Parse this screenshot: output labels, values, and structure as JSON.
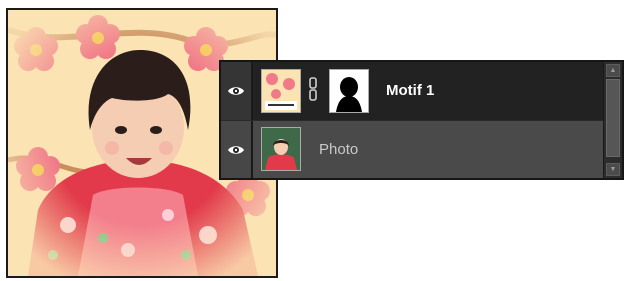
{
  "layers_panel": {
    "layers": [
      {
        "name": "Motif 1",
        "visible": true,
        "selected": true,
        "has_mask": true,
        "linked": true,
        "thumbnail_icon": "floral-pattern-thumbnail",
        "mask_icon": "silhouette-mask-thumbnail"
      },
      {
        "name": "Photo",
        "visible": true,
        "selected": false,
        "has_mask": false,
        "thumbnail_icon": "child-photo-thumbnail"
      }
    ],
    "scroll_up_glyph": "▲",
    "scroll_down_glyph": "▼"
  },
  "colors": {
    "panel_background": "#3d3d3d",
    "selected_row": "#222222",
    "unselected_row": "#4a4a4a",
    "selected_text": "#ffffff",
    "unselected_text": "#c9c9c9",
    "pattern_background": "#fbe3b4",
    "flower_pink": "#f07a88",
    "kimono_red": "#e23a4a"
  }
}
